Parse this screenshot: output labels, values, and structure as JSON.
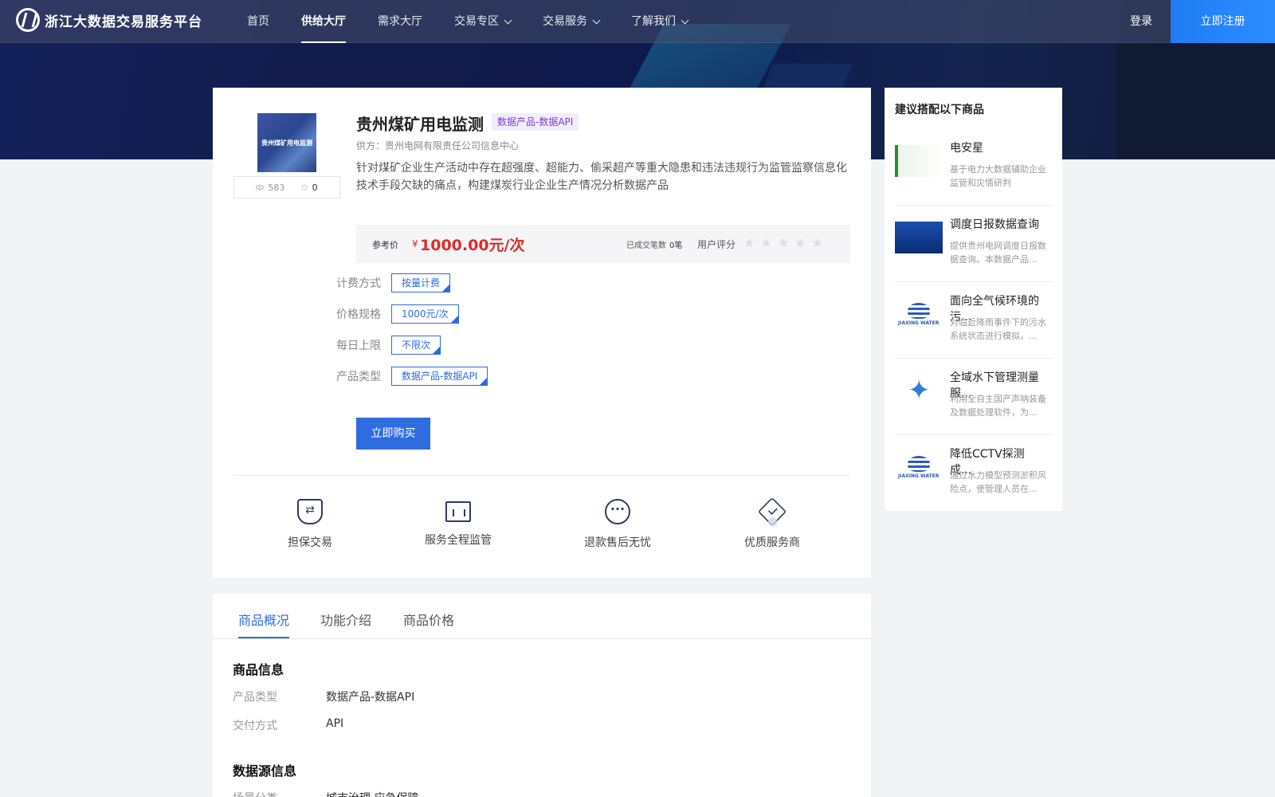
{
  "header": {
    "logo_text": "浙江大数据交易服务平台",
    "nav": [
      "首页",
      "供给大厅",
      "需求大厅",
      "交易专区",
      "交易服务",
      "了解我们"
    ],
    "login": "登录",
    "register": "立即注册"
  },
  "product": {
    "thumb_text": "贵州煤矿用电监测",
    "views": "583",
    "favorites": "0",
    "title": "贵州煤矿用电监测",
    "tag": "数据产品-数据API",
    "supplier": "供方：贵州电网有限责任公司信息中心",
    "description": "针对煤矿企业生产活动中存在超强度、超能力、偷采超产等重大隐患和违法违规行为监管监察信息化技术手段欠缺的痛点，构建煤炭行业企业生产情况分析数据产品",
    "price_label": "参考价",
    "currency": "¥",
    "price": "1000.00元/次",
    "deals_label": "已成交笔数",
    "deals_value": "0笔",
    "rating_label": "用户评分",
    "rating": 0,
    "rating_stars": "★★★★★",
    "options": [
      {
        "label": "计费方式",
        "value": "按量计费"
      },
      {
        "label": "价格规格",
        "value": "1000元/次"
      },
      {
        "label": "每日上限",
        "value": "不限次"
      },
      {
        "label": "产品类型",
        "value": "数据产品-数据API"
      }
    ],
    "buy_button": "立即购买",
    "features": [
      "担保交易",
      "服务全程监管",
      "退款售后无忧",
      "优质服务商"
    ]
  },
  "sidebar": {
    "title": "建议搭配以下商品",
    "items": [
      {
        "name": "电安星",
        "desc": "基于电力大数据辅助企业监管和灾情研判"
      },
      {
        "name": "调度日报数据查询",
        "desc": "提供贵州电网调度日报数据查询。本数据产品..."
      },
      {
        "name": "面向全气候环境的污...",
        "desc": "对临近降雨事件下的污水系统状态进行模拟，..."
      },
      {
        "name": "全域水下管理测量服...",
        "desc": "利用全自主国产声呐装备及数据处理软件，为..."
      },
      {
        "name": "降低CCTV探测成...",
        "desc": "通过水力模型预测淤积风险点，使管理人员在..."
      }
    ]
  },
  "details": {
    "tabs": [
      "商品概况",
      "功能介绍",
      "商品价格"
    ],
    "section1_title": "商品信息",
    "info": [
      {
        "key": "产品类型",
        "value": "数据产品-数据API"
      },
      {
        "key": "交付方式",
        "value": "API"
      }
    ],
    "section2_title": "数据源信息",
    "source": [
      {
        "key": "场景分类",
        "value": "城市治理,应急保障"
      }
    ]
  }
}
